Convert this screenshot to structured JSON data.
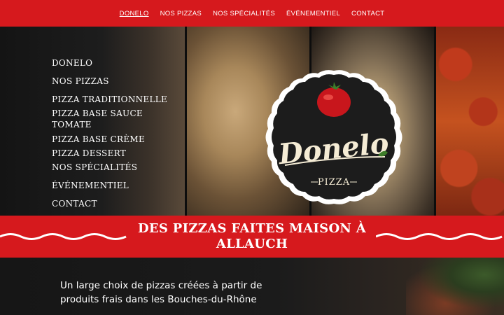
{
  "nav": {
    "items": [
      "DONELO",
      "NOS PIZZAS",
      "NOS SPÉCIALITÉS",
      "ÉVÉNEMENTIEL",
      "CONTACT"
    ]
  },
  "sidemenu": {
    "items": [
      "DONELO",
      "NOS PIZZAS",
      "PIZZA TRADITIONNELLE",
      "PIZZA BASE SAUCE TOMATE",
      "PIZZA BASE CRÈME",
      "PIZZA DESSERT",
      "NOS SPÉCIALITÉS",
      "ÉVÉNEMENTIEL",
      "CONTACT"
    ]
  },
  "logo": {
    "name": "Donelo",
    "tagline": "PIZZA"
  },
  "banner": {
    "title": "DES PIZZAS FAITES MAISON À ALLAUCH"
  },
  "intro": {
    "text": "Un large choix de pizzas créées à partir de produits frais dans les Bouches-du-Rhône"
  },
  "colors": {
    "brand_red": "#d6191d",
    "dark": "#161616",
    "white": "#ffffff"
  }
}
